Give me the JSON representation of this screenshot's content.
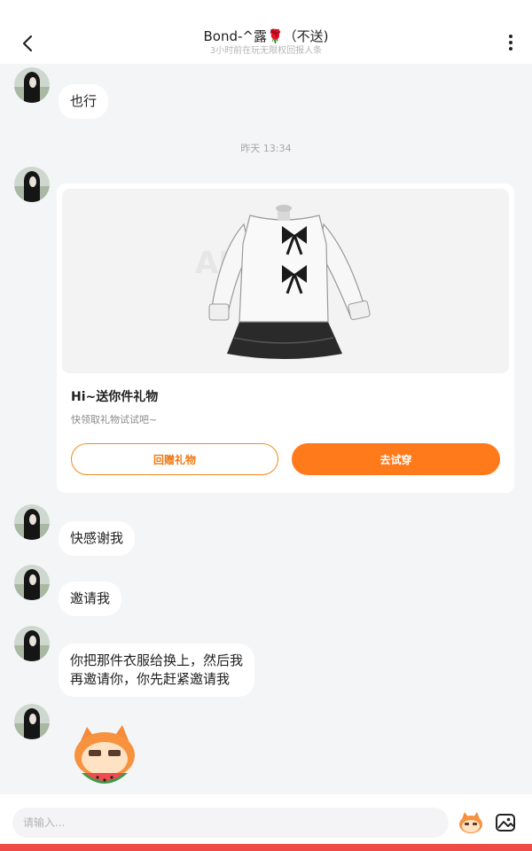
{
  "header": {
    "title": "Bond-^露🌹（不送)",
    "subtitle": "3小时前在玩无限权回报人条"
  },
  "messages": {
    "m1": "也行",
    "timestamp": "昨天 13:34",
    "gift": {
      "title": "Hi~送你件礼物",
      "subtitle": "快领取礼物试试吧~",
      "return_label": "回赠礼物",
      "try_label": "去试穿"
    },
    "m2": "快感谢我",
    "m3": "邀请我",
    "m4_line1": "你把那件衣服给换上，然后我",
    "m4_line2": "再邀请你，你先赶紧邀请我"
  },
  "input": {
    "placeholder": "请输入..."
  },
  "colors": {
    "accent": "#ff7a1a",
    "accent_border": "#f28a1e",
    "background": "#f4f5f7",
    "bottom_strip": "#ef4a46"
  }
}
